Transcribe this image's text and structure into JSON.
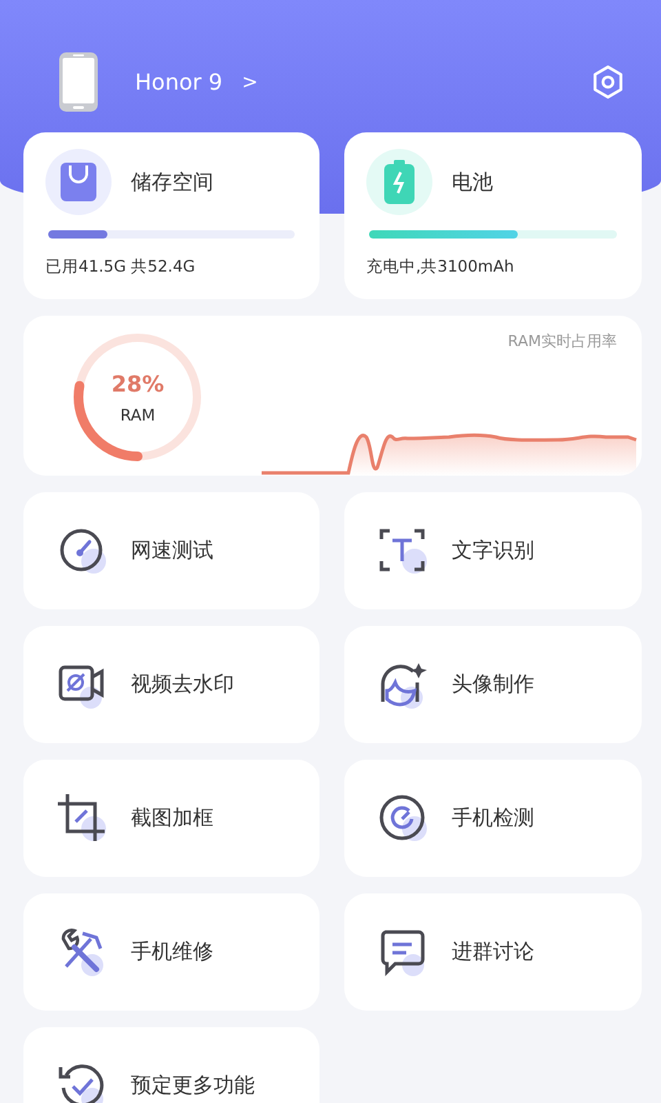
{
  "device": {
    "name": "Honor 9",
    "chevron": ">"
  },
  "storage": {
    "title": "储存空间",
    "level": 0.24,
    "detail": "已用41.5G 共52.4G"
  },
  "battery": {
    "title": "电池",
    "level": 0.6,
    "detail": "充电中,共3100mAh"
  },
  "ram": {
    "percent": "28%",
    "label": "RAM",
    "chart_title": "RAM实时占用率"
  },
  "tools": [
    {
      "label": "网速测试"
    },
    {
      "label": "文字识别"
    },
    {
      "label": "视频去水印"
    },
    {
      "label": "头像制作"
    },
    {
      "label": "截图加框"
    },
    {
      "label": "手机检测"
    },
    {
      "label": "手机维修"
    },
    {
      "label": "进群讨论"
    },
    {
      "label": "预定更多功能"
    }
  ]
}
